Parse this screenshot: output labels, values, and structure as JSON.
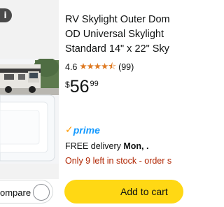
{
  "image": {
    "info_badge": "i",
    "compare_label": "ompare"
  },
  "product": {
    "title_lines": [
      "RV Skylight Outer Dom",
      "OD Universal Skylight",
      "Standard 14\" x 22\" Sky"
    ],
    "rating_value": "4.6",
    "rating_stars": 4.5,
    "rating_count": "(99)",
    "price_symbol": "$",
    "price_whole": "56",
    "price_fraction": "99",
    "prime_label": "prime",
    "delivery_prefix": "FREE delivery",
    "delivery_date": "Mon, .",
    "stock_text": "Only 9 left in stock - order s"
  },
  "actions": {
    "add_to_cart_label": "Add to cart"
  },
  "colors": {
    "star": "#de7921",
    "prime_blue": "#1399ff",
    "prime_check": "#ff9900",
    "stock_red": "#b12704",
    "cart_yellow": "#ffd814"
  }
}
